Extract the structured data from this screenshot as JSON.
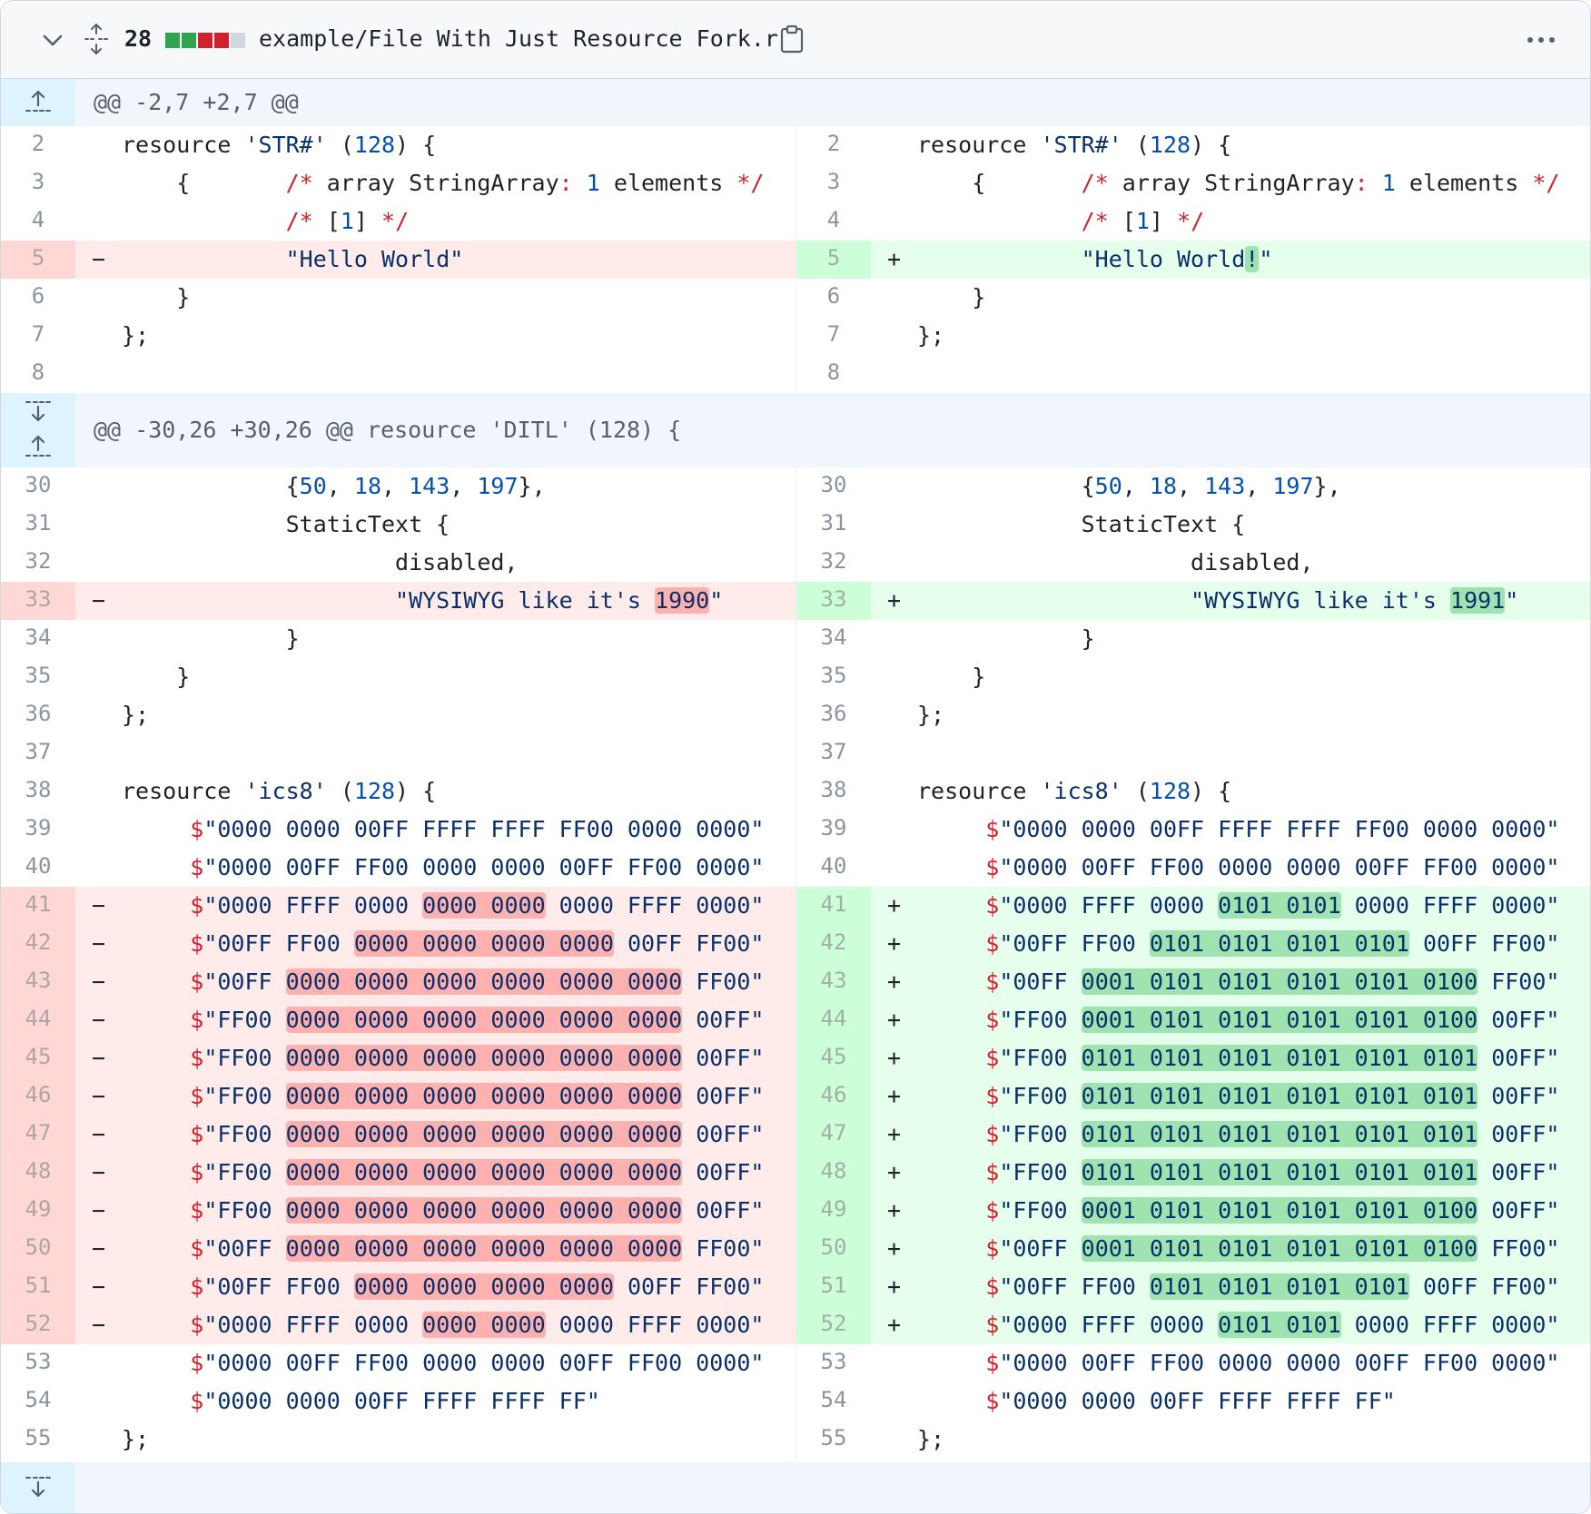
{
  "header": {
    "count": "28",
    "filename": "example/File With Just Resource Fork.r",
    "diffstat_colors": [
      "#2da44e",
      "#2da44e",
      "#cf222e",
      "#cf222e",
      "#d0d7de"
    ],
    "icons": {
      "collapse": "chevron-down-icon",
      "expand": "unfold-icon",
      "copy": "clipboard-icon",
      "more": "kebab-horizontal-icon"
    }
  },
  "hunks": [
    {
      "header": "@@ -2,7 +2,7 @@"
    },
    {
      "header": "@@ -30,26 +30,26 @@ resource 'DITL' (128) {"
    }
  ],
  "lines": [
    {
      "n": "2",
      "t": "ctx",
      "l": [
        [
          "",
          "resource "
        ],
        [
          "s",
          "'STR#'"
        ],
        [
          "",
          " ("
        ],
        [
          "n",
          "128"
        ],
        [
          "",
          ") {"
        ]
      ],
      "r": null
    },
    {
      "n": "3",
      "t": "ctx",
      "l": [
        [
          "",
          "    {       "
        ],
        [
          "c",
          "/* "
        ],
        [
          "",
          "array StringArray"
        ],
        [
          "c",
          ":"
        ],
        [
          "",
          " "
        ],
        [
          "n",
          "1"
        ],
        [
          "",
          " elements "
        ],
        [
          "c",
          "*/"
        ]
      ],
      "r": null
    },
    {
      "n": "4",
      "t": "ctx",
      "l": [
        [
          "",
          "            "
        ],
        [
          "c",
          "/* "
        ],
        [
          "",
          "["
        ],
        [
          "n",
          "1"
        ],
        [
          "",
          "] "
        ],
        [
          "c",
          "*/"
        ]
      ],
      "r": null
    },
    {
      "n": "5",
      "t": "chg",
      "l": [
        [
          "",
          "            "
        ],
        [
          "s",
          "\"Hello World\""
        ]
      ],
      "r": [
        [
          "",
          "            "
        ],
        [
          "s",
          "\"Hello World"
        ],
        [
          "sa",
          "!"
        ],
        [
          "s",
          "\""
        ]
      ]
    },
    {
      "n": "6",
      "t": "ctx",
      "l": [
        [
          "",
          "    }"
        ]
      ],
      "r": null
    },
    {
      "n": "7",
      "t": "ctx",
      "l": [
        [
          "",
          "};"
        ]
      ],
      "r": null
    },
    {
      "n": "8",
      "t": "ctx",
      "l": [
        [
          "",
          ""
        ]
      ],
      "r": null
    },
    {
      "hunk": 1
    },
    {
      "n": "30",
      "t": "ctx",
      "l": [
        [
          "",
          "            {"
        ],
        [
          "n",
          "50"
        ],
        [
          "",
          ", "
        ],
        [
          "n",
          "18"
        ],
        [
          "",
          ", "
        ],
        [
          "n",
          "143"
        ],
        [
          "",
          ", "
        ],
        [
          "n",
          "197"
        ],
        [
          "",
          "},"
        ]
      ],
      "r": null
    },
    {
      "n": "31",
      "t": "ctx",
      "l": [
        [
          "",
          "            StaticText {"
        ]
      ],
      "r": null
    },
    {
      "n": "32",
      "t": "ctx",
      "l": [
        [
          "",
          "                    disabled,"
        ]
      ],
      "r": null
    },
    {
      "n": "33",
      "t": "chg",
      "l": [
        [
          "",
          "                    "
        ],
        [
          "s",
          "\"WYSIWYG like it's "
        ],
        [
          "sd",
          "1990"
        ],
        [
          "s",
          "\""
        ]
      ],
      "r": [
        [
          "",
          "                    "
        ],
        [
          "s",
          "\"WYSIWYG like it's "
        ],
        [
          "sa",
          "1991"
        ],
        [
          "s",
          "\""
        ]
      ]
    },
    {
      "n": "34",
      "t": "ctx",
      "l": [
        [
          "",
          "            }"
        ]
      ],
      "r": null
    },
    {
      "n": "35",
      "t": "ctx",
      "l": [
        [
          "",
          "    }"
        ]
      ],
      "r": null
    },
    {
      "n": "36",
      "t": "ctx",
      "l": [
        [
          "",
          "};"
        ]
      ],
      "r": null
    },
    {
      "n": "37",
      "t": "ctx",
      "l": [
        [
          "",
          ""
        ]
      ],
      "r": null
    },
    {
      "n": "38",
      "t": "ctx",
      "l": [
        [
          "",
          "resource "
        ],
        [
          "s",
          "'ics8'"
        ],
        [
          "",
          " ("
        ],
        [
          "n",
          "128"
        ],
        [
          "",
          ") {"
        ]
      ],
      "r": null
    },
    {
      "n": "39",
      "t": "ctx",
      "l": [
        [
          "",
          "     "
        ],
        [
          "c",
          "$"
        ],
        [
          "s",
          "\"0000 0000 00FF FFFF FFFF FF00 0000 0000\""
        ]
      ],
      "r": null
    },
    {
      "n": "40",
      "t": "ctx",
      "l": [
        [
          "",
          "     "
        ],
        [
          "c",
          "$"
        ],
        [
          "s",
          "\"0000 00FF FF00 0000 0000 00FF FF00 0000\""
        ]
      ],
      "r": null
    },
    {
      "n": "41",
      "t": "chg",
      "l": [
        [
          "",
          "     "
        ],
        [
          "c",
          "$"
        ],
        [
          "s",
          "\"0000 FFFF 0000 "
        ],
        [
          "sd",
          "0000 0000"
        ],
        [
          "s",
          " 0000 FFFF 0000\""
        ]
      ],
      "r": [
        [
          "",
          "     "
        ],
        [
          "c",
          "$"
        ],
        [
          "s",
          "\"0000 FFFF 0000 "
        ],
        [
          "sa",
          "0101 0101"
        ],
        [
          "s",
          " 0000 FFFF 0000\""
        ]
      ]
    },
    {
      "n": "42",
      "t": "chg",
      "l": [
        [
          "",
          "     "
        ],
        [
          "c",
          "$"
        ],
        [
          "s",
          "\"00FF FF00 "
        ],
        [
          "sd",
          "0000 0000 0000 0000"
        ],
        [
          "s",
          " 00FF FF00\""
        ]
      ],
      "r": [
        [
          "",
          "     "
        ],
        [
          "c",
          "$"
        ],
        [
          "s",
          "\"00FF FF00 "
        ],
        [
          "sa",
          "0101 0101 0101 0101"
        ],
        [
          "s",
          " 00FF FF00\""
        ]
      ]
    },
    {
      "n": "43",
      "t": "chg",
      "l": [
        [
          "",
          "     "
        ],
        [
          "c",
          "$"
        ],
        [
          "s",
          "\"00FF "
        ],
        [
          "sd",
          "0000 0000 0000 0000 0000 0000"
        ],
        [
          "s",
          " FF00\""
        ]
      ],
      "r": [
        [
          "",
          "     "
        ],
        [
          "c",
          "$"
        ],
        [
          "s",
          "\"00FF "
        ],
        [
          "sa",
          "0001 0101 0101 0101 0101 0100"
        ],
        [
          "s",
          " FF00\""
        ]
      ]
    },
    {
      "n": "44",
      "t": "chg",
      "l": [
        [
          "",
          "     "
        ],
        [
          "c",
          "$"
        ],
        [
          "s",
          "\"FF00 "
        ],
        [
          "sd",
          "0000 0000 0000 0000 0000 0000"
        ],
        [
          "s",
          " 00FF\""
        ]
      ],
      "r": [
        [
          "",
          "     "
        ],
        [
          "c",
          "$"
        ],
        [
          "s",
          "\"FF00 "
        ],
        [
          "sa",
          "0001 0101 0101 0101 0101 0100"
        ],
        [
          "s",
          " 00FF\""
        ]
      ]
    },
    {
      "n": "45",
      "t": "chg",
      "l": [
        [
          "",
          "     "
        ],
        [
          "c",
          "$"
        ],
        [
          "s",
          "\"FF00 "
        ],
        [
          "sd",
          "0000 0000 0000 0000 0000 0000"
        ],
        [
          "s",
          " 00FF\""
        ]
      ],
      "r": [
        [
          "",
          "     "
        ],
        [
          "c",
          "$"
        ],
        [
          "s",
          "\"FF00 "
        ],
        [
          "sa",
          "0101 0101 0101 0101 0101 0101"
        ],
        [
          "s",
          " 00FF\""
        ]
      ]
    },
    {
      "n": "46",
      "t": "chg",
      "l": [
        [
          "",
          "     "
        ],
        [
          "c",
          "$"
        ],
        [
          "s",
          "\"FF00 "
        ],
        [
          "sd",
          "0000 0000 0000 0000 0000 0000"
        ],
        [
          "s",
          " 00FF\""
        ]
      ],
      "r": [
        [
          "",
          "     "
        ],
        [
          "c",
          "$"
        ],
        [
          "s",
          "\"FF00 "
        ],
        [
          "sa",
          "0101 0101 0101 0101 0101 0101"
        ],
        [
          "s",
          " 00FF\""
        ]
      ]
    },
    {
      "n": "47",
      "t": "chg",
      "l": [
        [
          "",
          "     "
        ],
        [
          "c",
          "$"
        ],
        [
          "s",
          "\"FF00 "
        ],
        [
          "sd",
          "0000 0000 0000 0000 0000 0000"
        ],
        [
          "s",
          " 00FF\""
        ]
      ],
      "r": [
        [
          "",
          "     "
        ],
        [
          "c",
          "$"
        ],
        [
          "s",
          "\"FF00 "
        ],
        [
          "sa",
          "0101 0101 0101 0101 0101 0101"
        ],
        [
          "s",
          " 00FF\""
        ]
      ]
    },
    {
      "n": "48",
      "t": "chg",
      "l": [
        [
          "",
          "     "
        ],
        [
          "c",
          "$"
        ],
        [
          "s",
          "\"FF00 "
        ],
        [
          "sd",
          "0000 0000 0000 0000 0000 0000"
        ],
        [
          "s",
          " 00FF\""
        ]
      ],
      "r": [
        [
          "",
          "     "
        ],
        [
          "c",
          "$"
        ],
        [
          "s",
          "\"FF00 "
        ],
        [
          "sa",
          "0101 0101 0101 0101 0101 0101"
        ],
        [
          "s",
          " 00FF\""
        ]
      ]
    },
    {
      "n": "49",
      "t": "chg",
      "l": [
        [
          "",
          "     "
        ],
        [
          "c",
          "$"
        ],
        [
          "s",
          "\"FF00 "
        ],
        [
          "sd",
          "0000 0000 0000 0000 0000 0000"
        ],
        [
          "s",
          " 00FF\""
        ]
      ],
      "r": [
        [
          "",
          "     "
        ],
        [
          "c",
          "$"
        ],
        [
          "s",
          "\"FF00 "
        ],
        [
          "sa",
          "0001 0101 0101 0101 0101 0100"
        ],
        [
          "s",
          " 00FF\""
        ]
      ]
    },
    {
      "n": "50",
      "t": "chg",
      "l": [
        [
          "",
          "     "
        ],
        [
          "c",
          "$"
        ],
        [
          "s",
          "\"00FF "
        ],
        [
          "sd",
          "0000 0000 0000 0000 0000 0000"
        ],
        [
          "s",
          " FF00\""
        ]
      ],
      "r": [
        [
          "",
          "     "
        ],
        [
          "c",
          "$"
        ],
        [
          "s",
          "\"00FF "
        ],
        [
          "sa",
          "0001 0101 0101 0101 0101 0100"
        ],
        [
          "s",
          " FF00\""
        ]
      ]
    },
    {
      "n": "51",
      "t": "chg",
      "l": [
        [
          "",
          "     "
        ],
        [
          "c",
          "$"
        ],
        [
          "s",
          "\"00FF FF00 "
        ],
        [
          "sd",
          "0000 0000 0000 0000"
        ],
        [
          "s",
          " 00FF FF00\""
        ]
      ],
      "r": [
        [
          "",
          "     "
        ],
        [
          "c",
          "$"
        ],
        [
          "s",
          "\"00FF FF00 "
        ],
        [
          "sa",
          "0101 0101 0101 0101"
        ],
        [
          "s",
          " 00FF FF00\""
        ]
      ]
    },
    {
      "n": "52",
      "t": "chg",
      "l": [
        [
          "",
          "     "
        ],
        [
          "c",
          "$"
        ],
        [
          "s",
          "\"0000 FFFF 0000 "
        ],
        [
          "sd",
          "0000 0000"
        ],
        [
          "s",
          " 0000 FFFF 0000\""
        ]
      ],
      "r": [
        [
          "",
          "     "
        ],
        [
          "c",
          "$"
        ],
        [
          "s",
          "\"0000 FFFF 0000 "
        ],
        [
          "sa",
          "0101 0101"
        ],
        [
          "s",
          " 0000 FFFF 0000\""
        ]
      ]
    },
    {
      "n": "53",
      "t": "ctx",
      "l": [
        [
          "",
          "     "
        ],
        [
          "c",
          "$"
        ],
        [
          "s",
          "\"0000 00FF FF00 0000 0000 00FF FF00 0000\""
        ]
      ],
      "r": null
    },
    {
      "n": "54",
      "t": "ctx",
      "l": [
        [
          "",
          "     "
        ],
        [
          "c",
          "$"
        ],
        [
          "s",
          "\"0000 0000 00FF FFFF FFFF FF\""
        ]
      ],
      "r": null
    },
    {
      "n": "55",
      "t": "ctx",
      "l": [
        [
          "",
          "};"
        ]
      ],
      "r": null
    }
  ],
  "signs": {
    "del": "−",
    "add": "+"
  }
}
